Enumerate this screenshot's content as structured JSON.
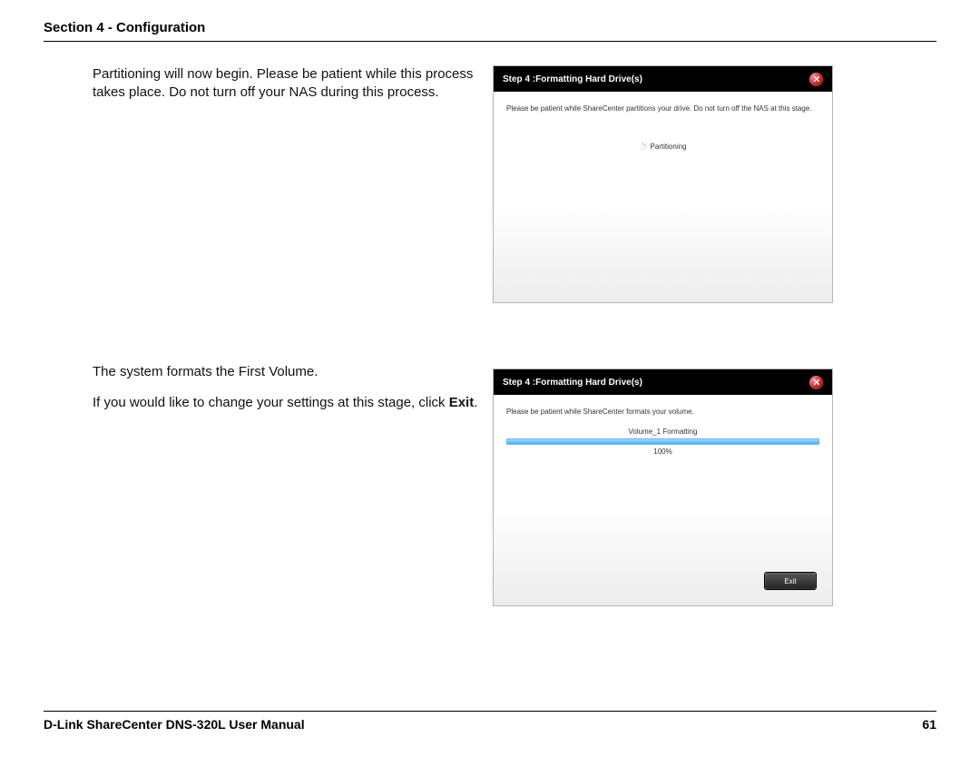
{
  "header": {
    "text": "Section 4 - Configuration"
  },
  "block1": {
    "para": "Partitioning will now begin. Please be patient while this process takes place. Do not turn off your NAS during this process."
  },
  "block2": {
    "para1": "The system formats the First Volume.",
    "para2_pre": "If you would like to change your settings at this stage, click ",
    "para2_bold": "Exit",
    "para2_post": "."
  },
  "dialog1": {
    "title": "Step 4 :Formatting Hard Drive(s)",
    "instruction": "Please be patient while ShareCenter partitions your drive. Do not turn off the NAS at this stage.",
    "status": "Partitioning"
  },
  "dialog2": {
    "title": "Step 4 :Formatting Hard Drive(s)",
    "instruction": "Please be patient while ShareCenter formats your volume.",
    "vol_label": "Volume_1 Formatting",
    "percent": "100%",
    "exit_label": "Exit"
  },
  "footer": {
    "left": "D-Link ShareCenter DNS-320L User Manual",
    "right": "61"
  }
}
